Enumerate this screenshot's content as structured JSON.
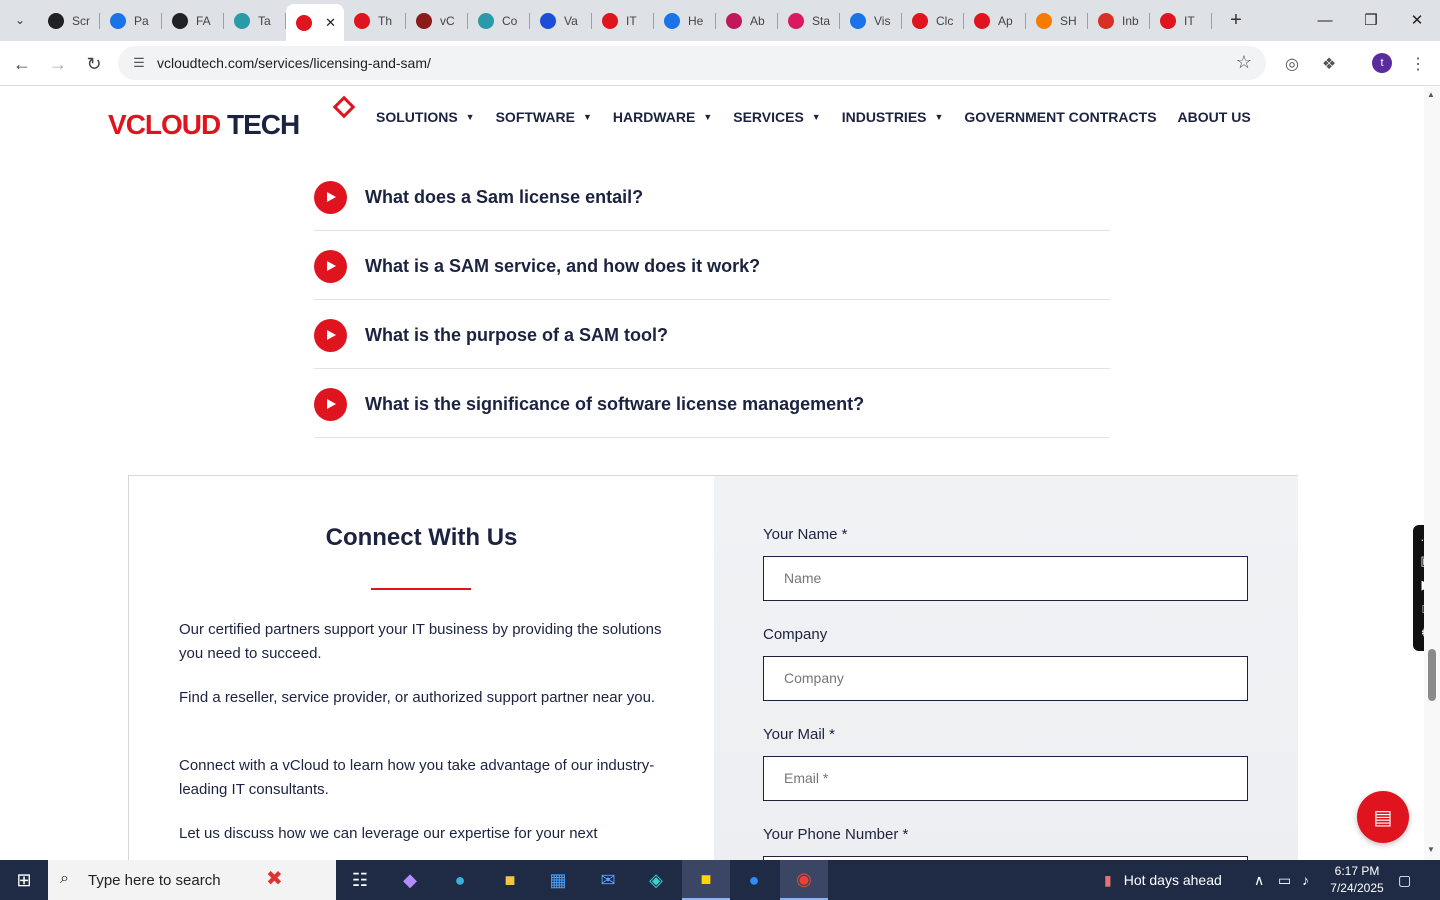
{
  "browser": {
    "tabs": [
      {
        "label": "Scr",
        "icon": "google-lens-icon",
        "color": "#202124"
      },
      {
        "label": "Pa",
        "icon": "pagespeed-icon",
        "color": "#1a73e8"
      },
      {
        "label": "FA",
        "icon": "openai-icon",
        "color": "#202124"
      },
      {
        "label": "Ta",
        "icon": "tab-teal-icon",
        "color": "#2b9aa8"
      },
      {
        "label": "",
        "icon": "vcloud-diamond-icon",
        "color": "#e0141e",
        "active": true
      },
      {
        "label": "Th",
        "icon": "vcloud-diamond-icon",
        "color": "#e0141e"
      },
      {
        "label": "vC",
        "icon": "v-check-icon",
        "color": "#8b1a1a"
      },
      {
        "label": "Co",
        "icon": "tab-teal-icon",
        "color": "#2b9aa8"
      },
      {
        "label": "Va",
        "icon": "x-cross-icon",
        "color": "#1a4fd6"
      },
      {
        "label": "IT",
        "icon": "vcloud-diamond-icon",
        "color": "#e0141e"
      },
      {
        "label": "He",
        "icon": "translate-icon",
        "color": "#1a73e8"
      },
      {
        "label": "Ab",
        "icon": "asana-icon",
        "color": "#c2185b"
      },
      {
        "label": "Sta",
        "icon": "pen-icon",
        "color": "#d81b60"
      },
      {
        "label": "Vis",
        "icon": "pulse-icon",
        "color": "#1a73e8"
      },
      {
        "label": "Clc",
        "icon": "signature-icon",
        "color": "#e0141e"
      },
      {
        "label": "Ap",
        "icon": "vcloud-diamond-icon",
        "color": "#e0141e"
      },
      {
        "label": "SH",
        "icon": "ring-icon",
        "color": "#f57c00"
      },
      {
        "label": "Inb",
        "icon": "gmail-icon",
        "color": "#d93025"
      },
      {
        "label": "IT",
        "icon": "vcloud-diamond-icon",
        "color": "#e0141e"
      }
    ],
    "url": "vcloudtech.com/services/licensing-and-sam/",
    "profile_initial": "t"
  },
  "site": {
    "logo": {
      "v": "V",
      "cloud": "CLOUD",
      "tech": "TECH"
    },
    "nav": [
      {
        "label": "SOLUTIONS",
        "dropdown": true
      },
      {
        "label": "SOFTWARE",
        "dropdown": true
      },
      {
        "label": "HARDWARE",
        "dropdown": true
      },
      {
        "label": "SERVICES",
        "dropdown": true
      },
      {
        "label": "INDUSTRIES",
        "dropdown": true
      },
      {
        "label": "GOVERNMENT CONTRACTS",
        "dropdown": false
      },
      {
        "label": "ABOUT US",
        "dropdown": false
      }
    ],
    "faq": [
      "What does a Sam license entail?",
      "What is a SAM service, and how does it work?",
      "What is the purpose of a SAM tool?",
      "What is the significance of software license management?"
    ],
    "connect": {
      "title": "Connect With Us",
      "paragraphs": [
        "Our certified partners support your IT business by providing the solutions you need to succeed.",
        "Find a reseller, service provider, or authorized support partner near you.",
        "Connect with a vCloud to learn how you take advantage of our industry-leading IT consultants.",
        "Let us discuss how we can leverage our expertise for your next"
      ],
      "form": {
        "name_label": "Your Name *",
        "name_placeholder": "Name",
        "company_label": "Company",
        "company_placeholder": "Company",
        "mail_label": "Your Mail *",
        "mail_placeholder": "Email *",
        "phone_label": "Your Phone Number *"
      }
    }
  },
  "taskbar": {
    "search_placeholder": "Type here to search",
    "weather": "Hot days ahead",
    "time": "6:17 PM",
    "date": "7/24/2025"
  },
  "colors": {
    "brand_red": "#e0141e",
    "navy": "#1c2340"
  }
}
